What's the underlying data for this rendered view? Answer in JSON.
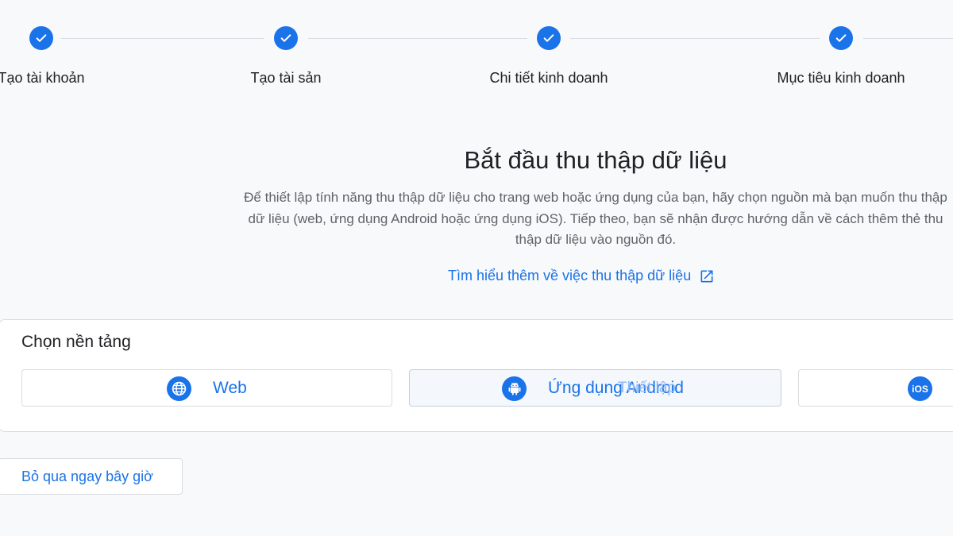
{
  "stepper": {
    "steps": [
      {
        "label": "Tạo tài khoản",
        "status": "completed",
        "icon": "check-icon"
      },
      {
        "label": "Tạo tài sản",
        "status": "completed",
        "icon": "check-icon"
      },
      {
        "label": "Chi tiết kinh doanh",
        "status": "completed",
        "icon": "check-icon"
      },
      {
        "label": "Mục tiêu kinh doanh",
        "status": "completed",
        "icon": "check-icon"
      }
    ]
  },
  "main": {
    "title": "Bắt đầu thu thập dữ liệu",
    "description_lines": [
      "Để thiết lập tính năng thu thập dữ liệu cho trang web hoặc ứng dụng của bạn, hãy chọn nguồn mà bạn muốn thu thập",
      "dữ liệu (web, ứng dụng Android hoặc ứng dụng iOS). Tiếp theo, bạn sẽ nhận được hướng dẫn về cách thêm thẻ thu",
      "thập dữ liệu vào nguồn đó."
    ],
    "learn_more_link": "Tìm hiểu thêm về việc thu thập dữ liệu",
    "learn_more_icon": "open-in-new-icon"
  },
  "platform_card": {
    "title": "Chọn nền tảng",
    "options": [
      {
        "label": "Web",
        "icon": "globe-icon"
      },
      {
        "label": "Ứng dụng Android",
        "overlay_label": "Thiết lập",
        "icon": "android-icon"
      },
      {
        "label": "",
        "icon": "ios-icon",
        "icon_text": "iOS"
      }
    ]
  },
  "footer": {
    "skip_button": "Bỏ qua ngay bây giờ"
  },
  "colors": {
    "accent": "#1a73e8",
    "background": "#f8f9fa",
    "text_primary": "#202124",
    "text_secondary": "#5f6368",
    "border": "#dadce0"
  }
}
